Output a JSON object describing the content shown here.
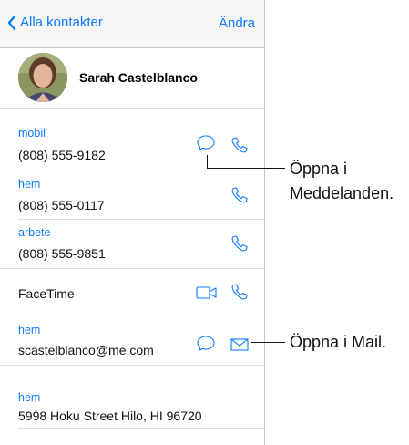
{
  "nav": {
    "back_label": "Alla kontakter",
    "edit_label": "Ändra"
  },
  "contact": {
    "name": "Sarah Castelblanco"
  },
  "phones": [
    {
      "label": "mobil",
      "value": "(808) 555-9182"
    },
    {
      "label": "hem",
      "value": "(808) 555-0117"
    },
    {
      "label": "arbete",
      "value": "(808) 555-9851"
    }
  ],
  "facetime": {
    "label": "FaceTime"
  },
  "email": {
    "label": "hem",
    "value": "scastelblanco@me.com"
  },
  "address": {
    "label": "hem",
    "value": "5998 Hoku Street Hilo, HI 96720"
  },
  "callouts": {
    "messages_line1": "Öppna i",
    "messages_line2": "Meddelanden.",
    "mail": "Öppna i Mail."
  },
  "colors": {
    "accent": "#0a7aff",
    "separator": "#dcdce0",
    "navbar": "#f7f7f7"
  }
}
